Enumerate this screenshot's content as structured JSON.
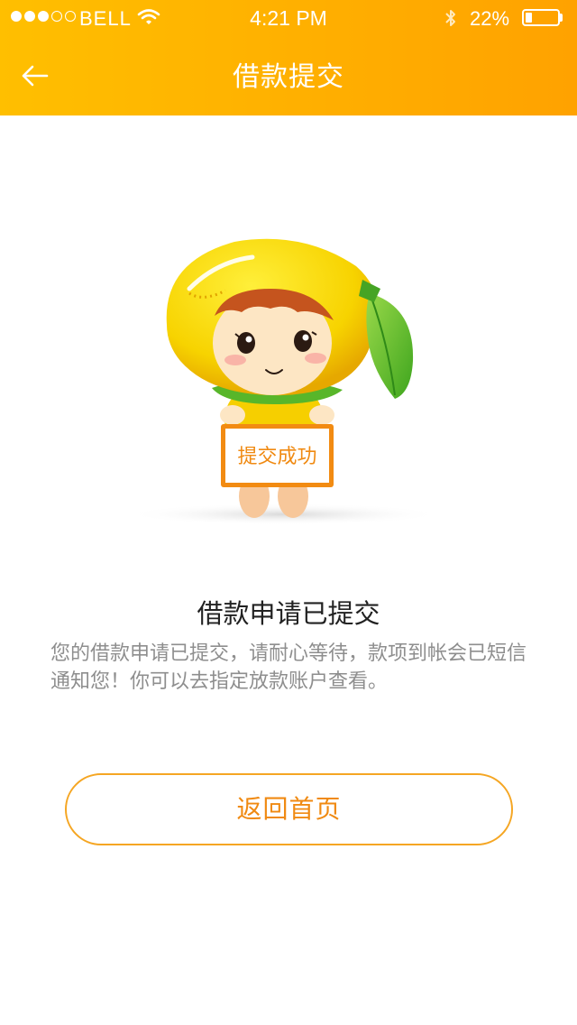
{
  "status_bar": {
    "carrier": "BELL",
    "time": "4:21 PM",
    "battery_percent": "22%",
    "battery_level": 0.22,
    "signal_bars_filled": 3,
    "signal_bars_total": 5,
    "icons": [
      "wifi-icon",
      "bluetooth-icon",
      "battery-icon"
    ]
  },
  "nav": {
    "back_icon": "arrow-left-icon",
    "title": "借款提交"
  },
  "illustration": {
    "sign_text": "提交成功"
  },
  "result": {
    "headline": "借款申请已提交",
    "description": "您的借款申请已提交，请耐心等待，款项到帐会已短信通知您！你可以去指定放款账户查看。"
  },
  "actions": {
    "home_label": "返回首页"
  },
  "colors": {
    "header_gradient_start": "#ffbf00",
    "header_gradient_end": "#ffa200",
    "accent": "#f08a12",
    "button_border": "#f5a623",
    "headline": "#222222",
    "description": "#8e8e8e"
  }
}
